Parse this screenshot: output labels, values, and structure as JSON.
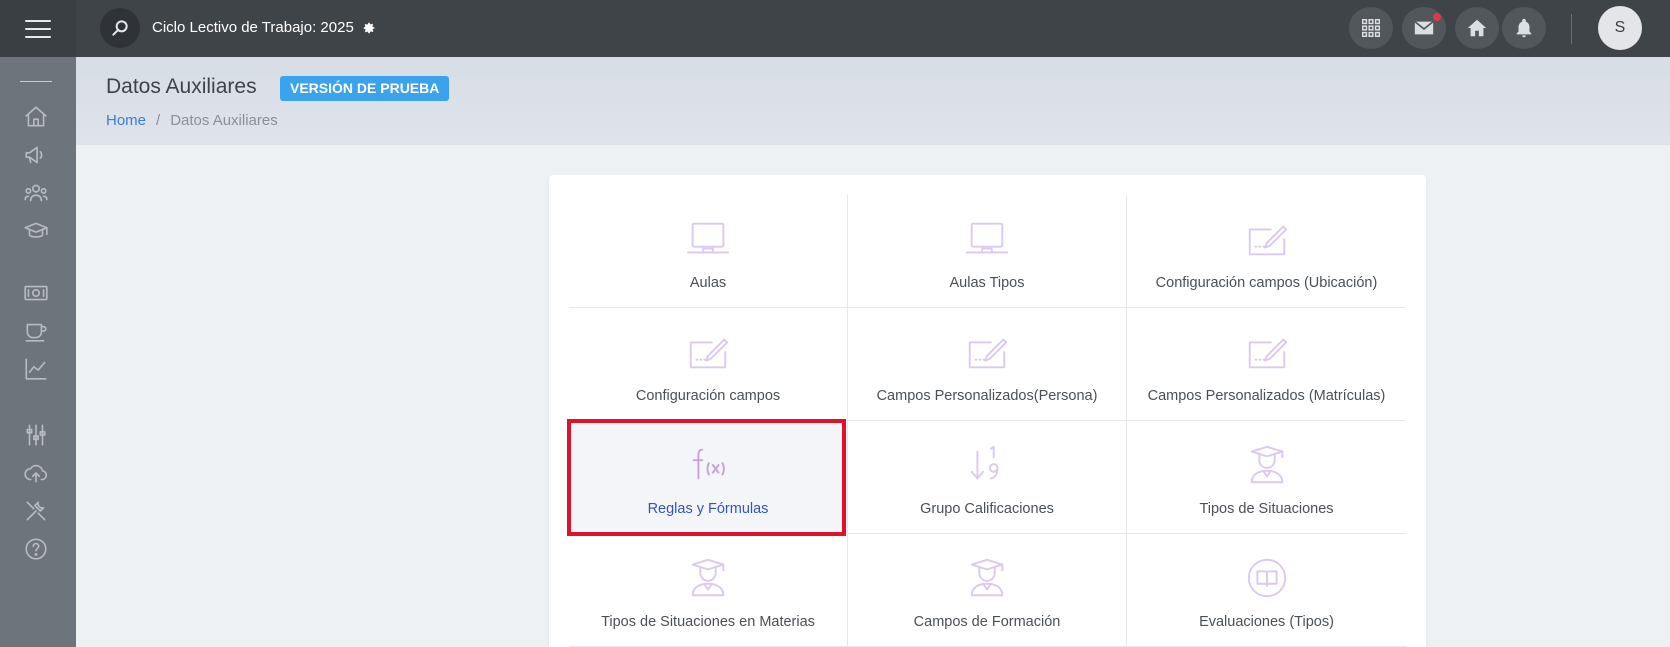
{
  "topbar": {
    "cycle_label": "Ciclo Lectivo de Trabajo: 2025",
    "avatar_initial": "S"
  },
  "page": {
    "title": "Datos Auxiliares",
    "badge": "VERSIÓN DE PRUEBA",
    "breadcrumb": {
      "home": "Home",
      "separator": "/",
      "current": "Datos Auxiliares"
    }
  },
  "tiles": [
    {
      "label": "Aulas",
      "icon": "laptop-icon"
    },
    {
      "label": "Aulas Tipos",
      "icon": "laptop-icon"
    },
    {
      "label": "Configuración campos (Ubicación)",
      "icon": "edit-field-icon"
    },
    {
      "label": "Configuración campos",
      "icon": "edit-field-icon"
    },
    {
      "label": "Campos Personalizados(Persona)",
      "icon": "edit-field-icon"
    },
    {
      "label": "Campos Personalizados (Matrículas)",
      "icon": "edit-field-icon"
    },
    {
      "label": "Reglas y Fórmulas",
      "icon": "function-icon"
    },
    {
      "label": "Grupo Calificaciones",
      "icon": "sort-numeric-icon"
    },
    {
      "label": "Tipos de Situaciones",
      "icon": "graduate-icon"
    },
    {
      "label": "Tipos de Situaciones en Materias",
      "icon": "graduate-icon"
    },
    {
      "label": "Campos de Formación",
      "icon": "graduate-icon"
    },
    {
      "label": "Evaluaciones (Tipos)",
      "icon": "book-circle-icon"
    }
  ],
  "colors": {
    "accent": "#3ba2ee",
    "highlight": "#e0112b",
    "icon_tint": "#d9c8ee"
  }
}
